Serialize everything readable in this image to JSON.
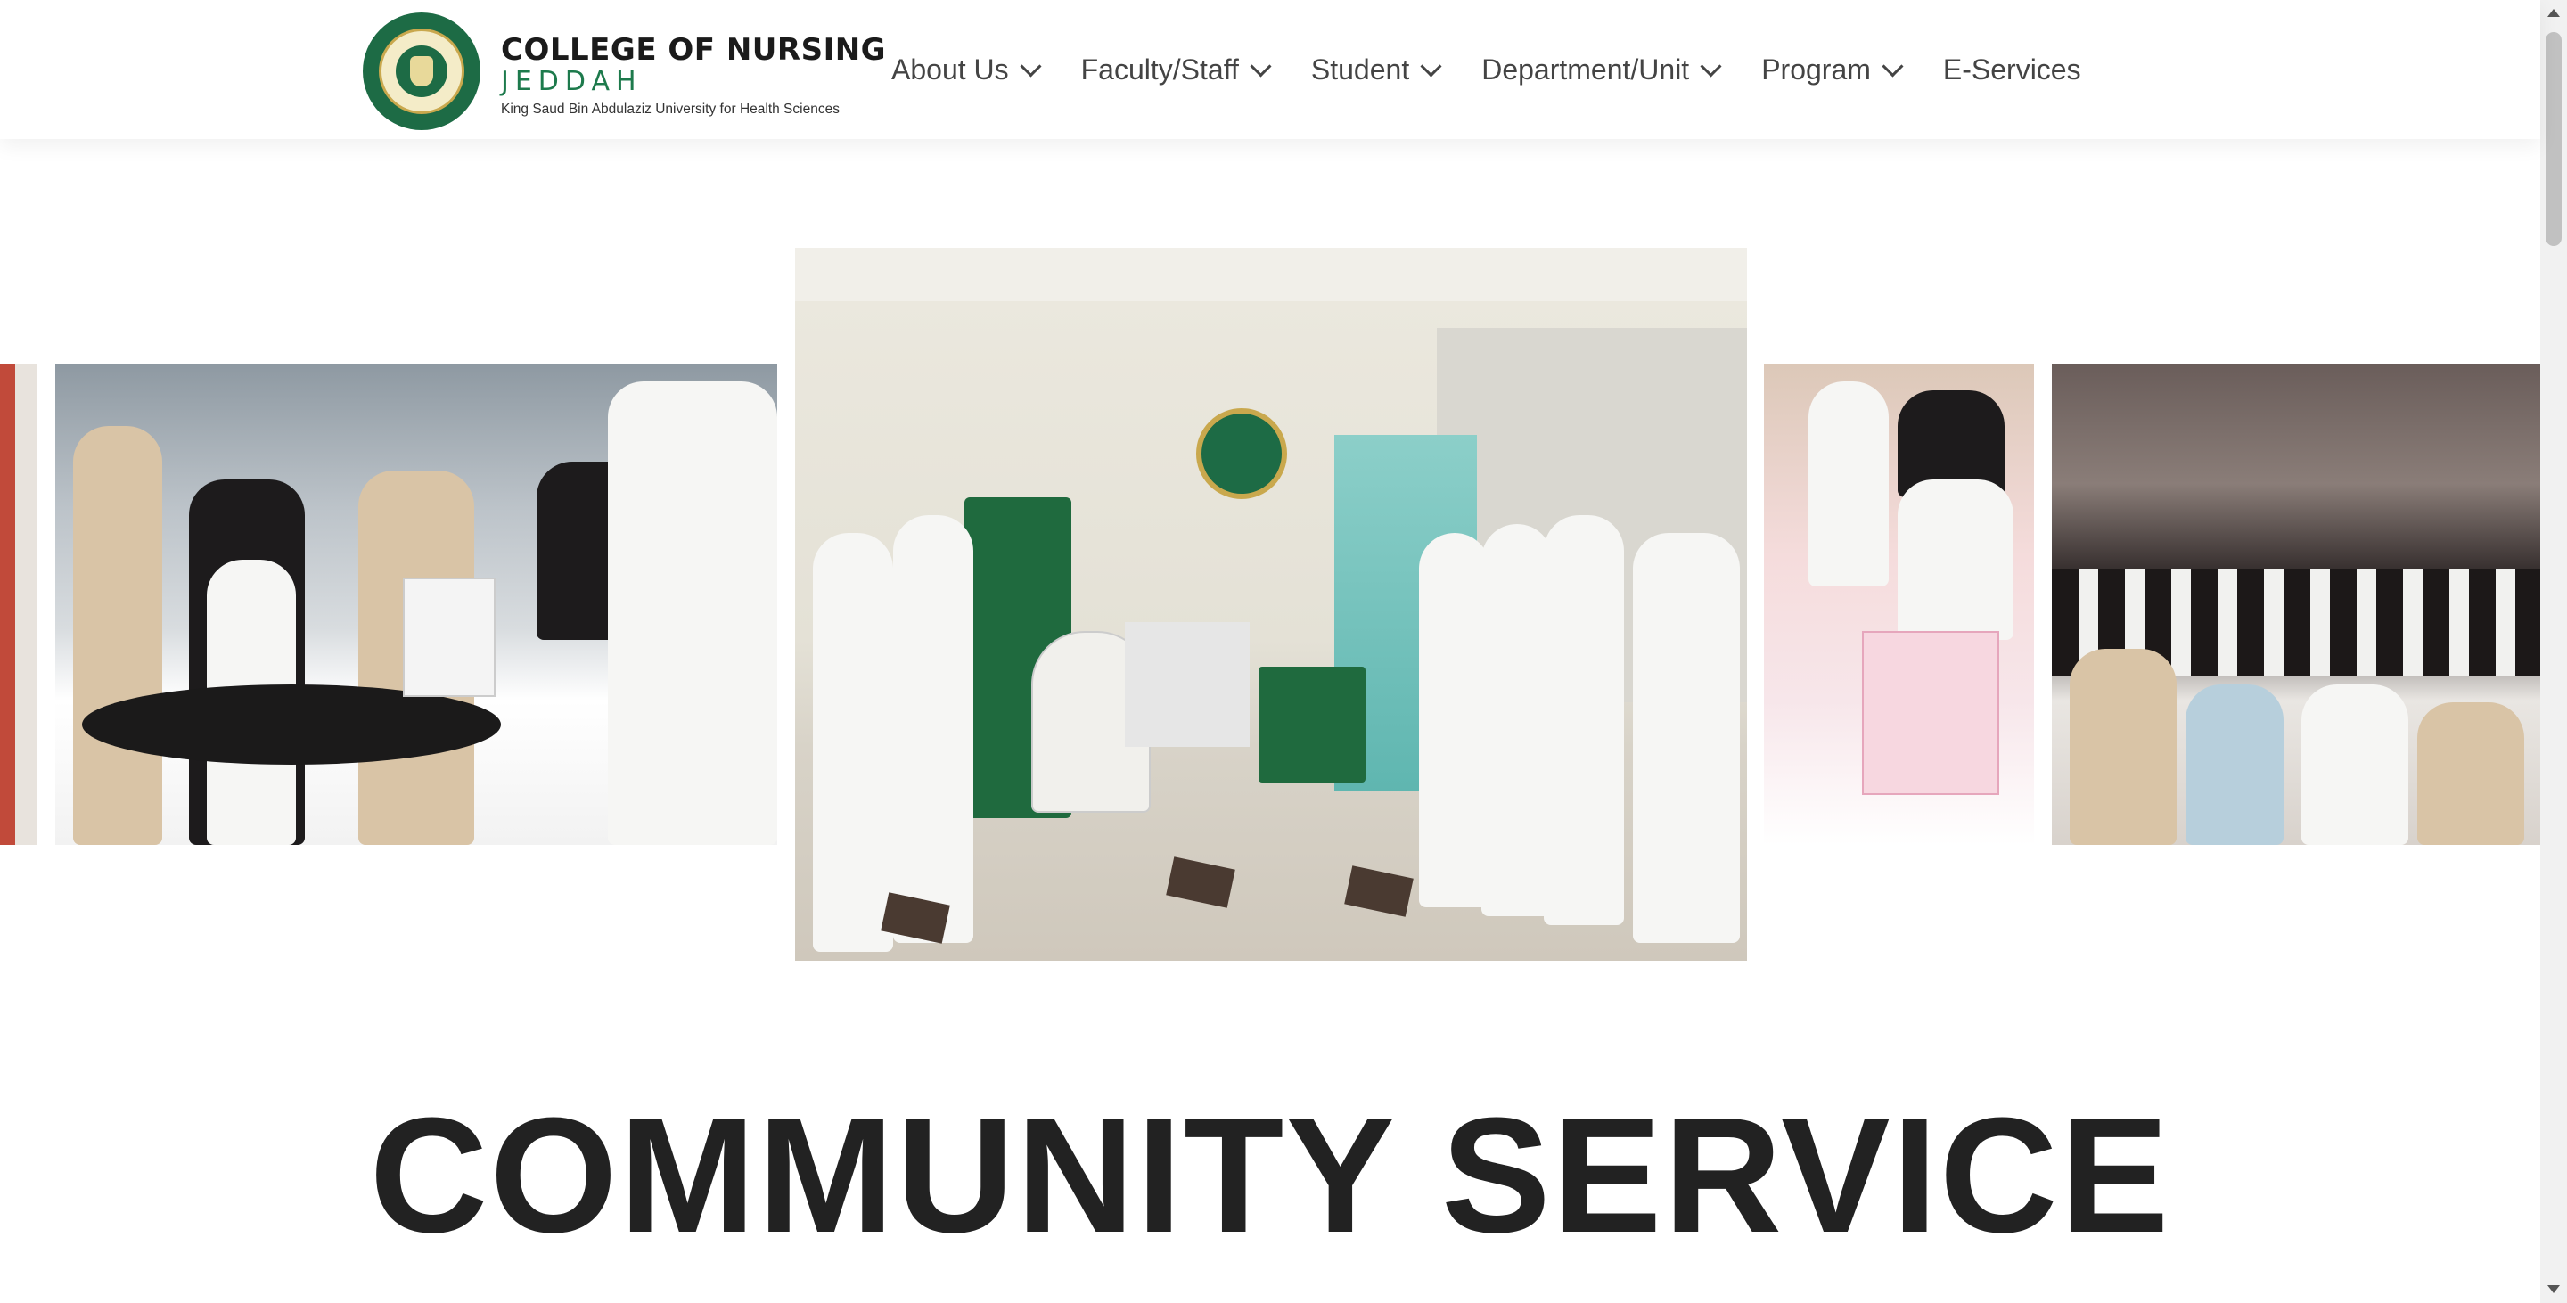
{
  "header": {
    "brand": {
      "line1": "COLLEGE OF NURSING",
      "line2": "JEDDAH",
      "line3": "King Saud Bin Abdulaziz University for Health Sciences"
    },
    "nav": [
      {
        "label": "About Us",
        "has_dropdown": true
      },
      {
        "label": "Faculty/Staff",
        "has_dropdown": true
      },
      {
        "label": "Student",
        "has_dropdown": true
      },
      {
        "label": "Department/Unit",
        "has_dropdown": true
      },
      {
        "label": "Program",
        "has_dropdown": true
      },
      {
        "label": "E-Services",
        "has_dropdown": false
      }
    ]
  },
  "carousel": {
    "slides": [
      {
        "id": "slide-partial-left",
        "signage": ""
      },
      {
        "id": "slide-research-unit",
        "signage": ""
      },
      {
        "id": "slide-nursing-lobby",
        "signage": ""
      },
      {
        "id": "slide-awareness-table",
        "signage": ""
      },
      {
        "id": "slide-auditorium",
        "signage": ""
      }
    ]
  },
  "section": {
    "title": "COMMUNITY SERVICE"
  },
  "colors": {
    "brand_green": "#1d6b45",
    "brand_gold": "#c9a84d",
    "nav_text": "#444444",
    "heading_text": "#222222"
  }
}
